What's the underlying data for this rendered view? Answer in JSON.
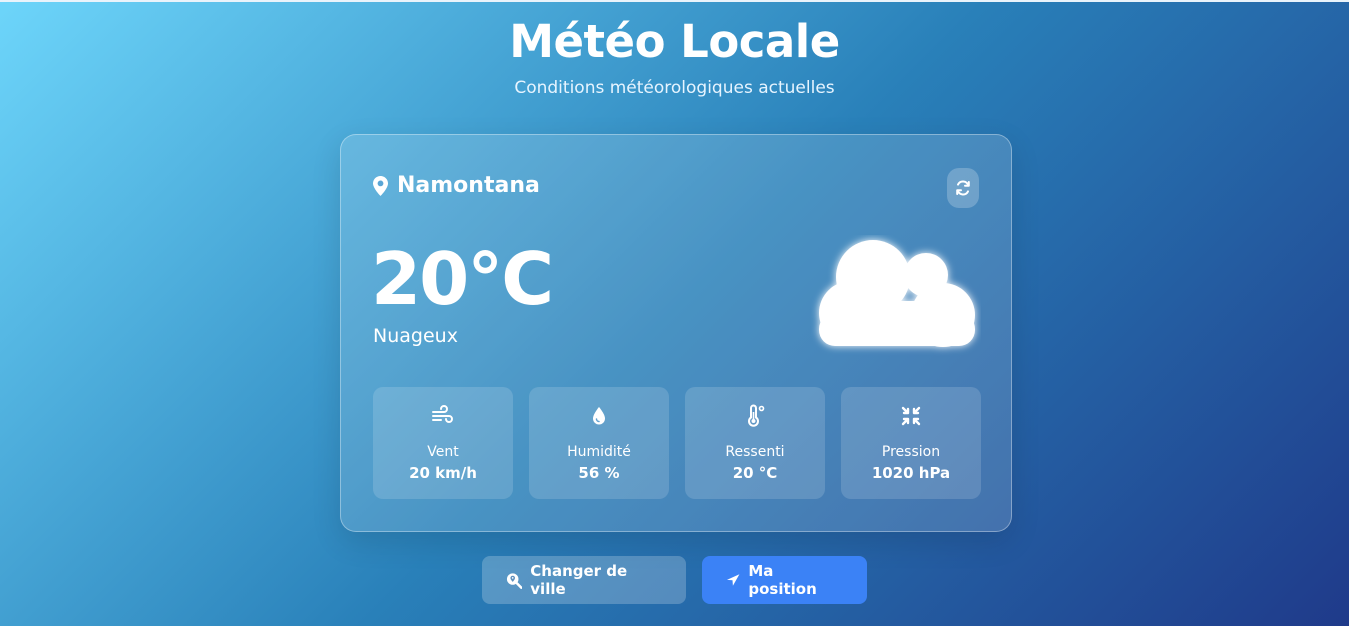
{
  "header": {
    "title": "Météo Locale",
    "subtitle": "Conditions météorologiques actuelles"
  },
  "weather": {
    "city": "Namontana",
    "temperature": "20°C",
    "condition": "Nuageux",
    "condition_icon": "cloud-icon"
  },
  "stats": [
    {
      "icon": "wind-icon",
      "label": "Vent",
      "value": "20 km/h"
    },
    {
      "icon": "droplet-icon",
      "label": "Humidité",
      "value": "56 %"
    },
    {
      "icon": "thermometer-icon",
      "label": "Ressenti",
      "value": "20 °C"
    },
    {
      "icon": "compress-icon",
      "label": "Pression",
      "value": "1020 hPa"
    }
  ],
  "actions": {
    "change_city": "Changer de ville",
    "my_position": "Ma position"
  },
  "colors": {
    "accent": "#3b82f6",
    "gradient_start": "#6dd5fa",
    "gradient_end": "#1f3a8a"
  }
}
